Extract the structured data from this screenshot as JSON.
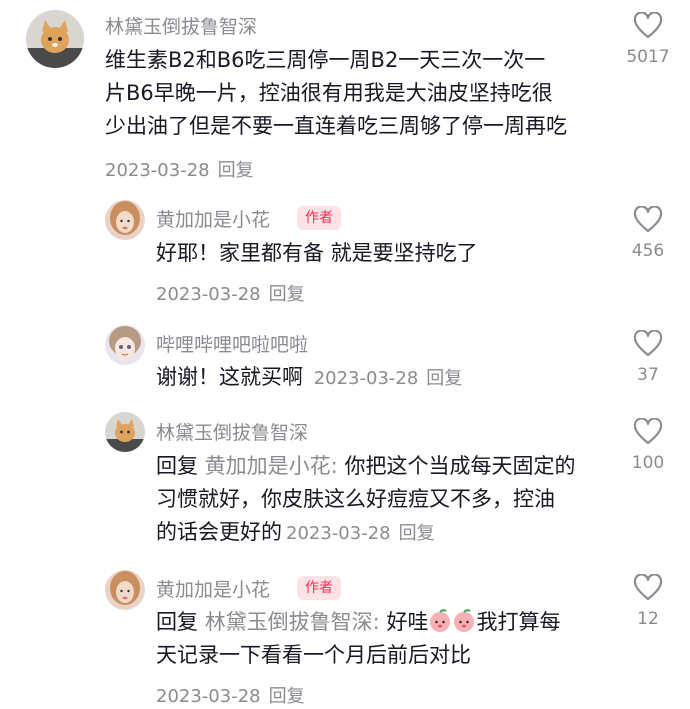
{
  "comments": [
    {
      "username": "林黛玉倒拔鲁智深",
      "text_lines": [
        "维生素B2和B6吃三周停一周B2一天三次一次一",
        "片B6早晚一片，控油很有用我是大油皮坚持吃很",
        "少出油了但是不要一直连着吃三周够了停一周再吃"
      ],
      "date": "2023-03-28",
      "reply_label": "回复",
      "likes": "5017"
    },
    {
      "username": "黄加加是小花",
      "badge": "作者",
      "text": "好耶！家里都有备 就是要坚持吃了",
      "date": "2023-03-28",
      "reply_label": "回复",
      "likes": "456"
    },
    {
      "username": "哔哩哔哩吧啦吧啦",
      "text": "谢谢！这就买啊",
      "date": "2023-03-28",
      "reply_label": "回复",
      "likes": "37"
    },
    {
      "username": "林黛玉倒拔鲁智深",
      "reply_prefix": "回复",
      "reply_to": "黄加加是小花:",
      "text_lines": [
        "你把这个当成每天固定的",
        "习惯就好，你皮肤这么好痘痘又不多，控油",
        "的话会更好的"
      ],
      "date": "2023-03-28",
      "reply_label": "回复",
      "likes": "100"
    },
    {
      "username": "黄加加是小花",
      "badge": "作者",
      "reply_prefix": "回复",
      "reply_to": "林黛玉倒拔鲁智深:",
      "text_lines": [
        "好哇",
        "我打算每",
        "天记录一下看看一个月后前后对比"
      ],
      "emoji": "peach-face-icon",
      "date": "2023-03-28",
      "reply_label": "回复",
      "likes": "12"
    }
  ]
}
